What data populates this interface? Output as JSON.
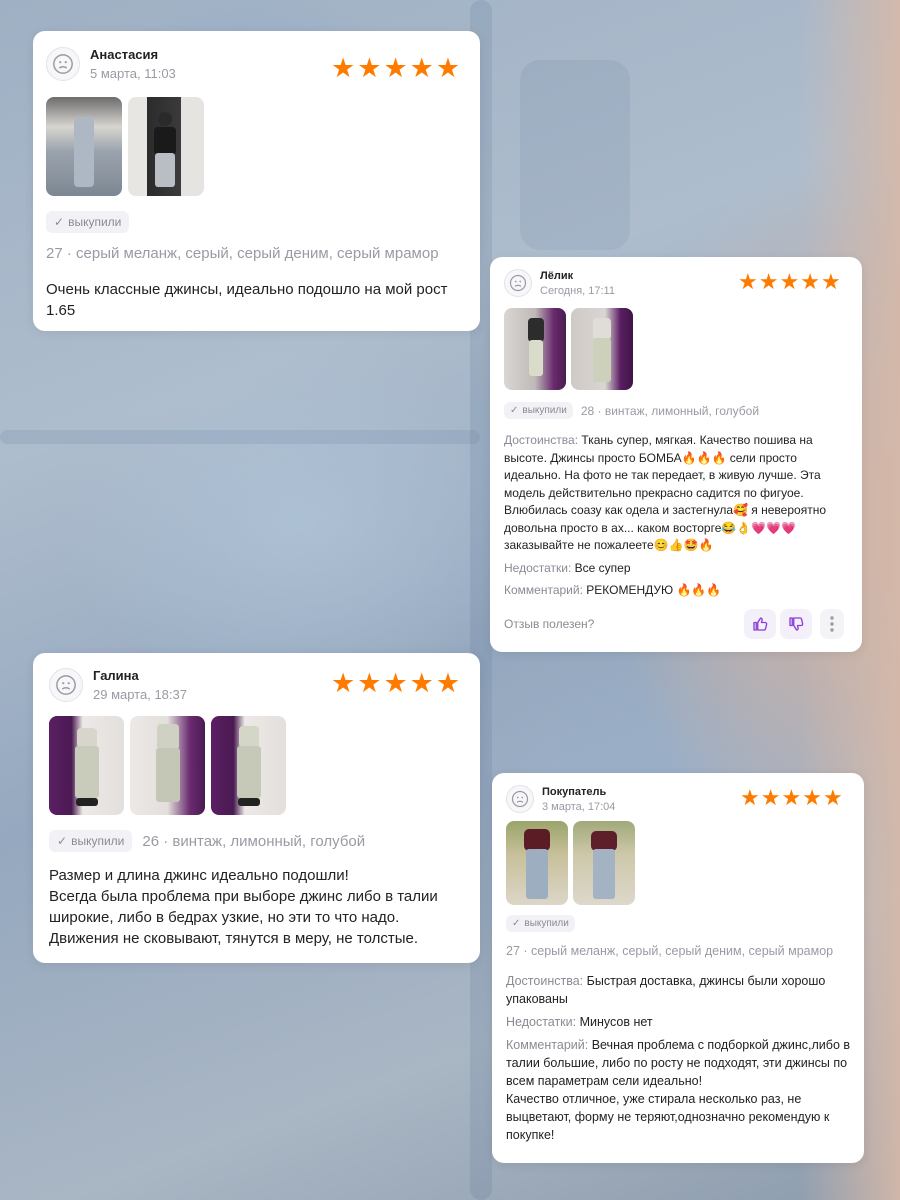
{
  "reviews": [
    {
      "name": "Анастасия",
      "date": "5 марта, 11:03",
      "rating": 5,
      "badge": "выкупили",
      "meta": "27 · серый меланж, серый, серый деним, серый мрамор",
      "text": "Очень классные джинсы, идеально подошло на мой рост 1.65"
    },
    {
      "name": "Лёлик",
      "date": "Сегодня, 17:11",
      "rating": 5,
      "badge": "выкупили",
      "meta": "28 · винтаж, лимонный, голубой",
      "pros_label": "Достоинства:",
      "pros": "Ткань супер, мягкая. Качество пошива на высоте. Джинсы просто БОМБА🔥🔥🔥 сели просто идеально. На фото не так передает, в живую лучше. Эта модель действительно прекрасно садится по фигуое. Влюбилась соазу как одела и застегнула🥰 я невероятно довольна просто в ах... каком восторге😂👌💗💗💗 заказывайте не пожалеете😊👍🤩🔥",
      "cons_label": "Недостатки:",
      "cons": "Все супер",
      "comment_label": "Комментарий:",
      "comment": "РЕКОМЕНДУЮ 🔥🔥🔥",
      "helpful": "Отзыв полезен?"
    },
    {
      "name": "Галина",
      "date": "29 марта, 18:37",
      "rating": 5,
      "badge": "выкупили",
      "meta": "26 · винтаж, лимонный, голубой",
      "text": "Размер и длина джинс идеально подошли!\nВсегда была проблема при выборе джинс либо в талии широкие, либо в бедрах узкие, но эти то что надо.\nДвижения не сковывают, тянутся в меру, не толстые."
    },
    {
      "name": "Покупатель",
      "date": "3 марта, 17:04",
      "rating": 5,
      "badge": "выкупили",
      "meta": "27 · серый меланж, серый, серый деним, серый мрамор",
      "pros_label": "Достоинства:",
      "pros": "Быстрая доставка, джинсы были хорошо упакованы",
      "cons_label": "Недостатки:",
      "cons": "Минусов нет",
      "comment_label": "Комментарий:",
      "comment": "Вечная проблема с подборкой джинс,либо в талии большие, либо по росту не подходят, эти джинсы по всем параметрам сели идеально!\nКачество отличное, уже стирала несколько раз, не выцветают, форму не теряют,однозначно рекомендую к покупке!"
    }
  ],
  "colors": {
    "star": "#ff7b00",
    "accent": "#8b3dd6",
    "badge_bg": "#f2f2f6"
  },
  "icons": [
    "user-avatar-icon",
    "star-icon",
    "check-icon",
    "thumbs-up-icon",
    "thumbs-down-icon",
    "more-vertical-icon"
  ]
}
